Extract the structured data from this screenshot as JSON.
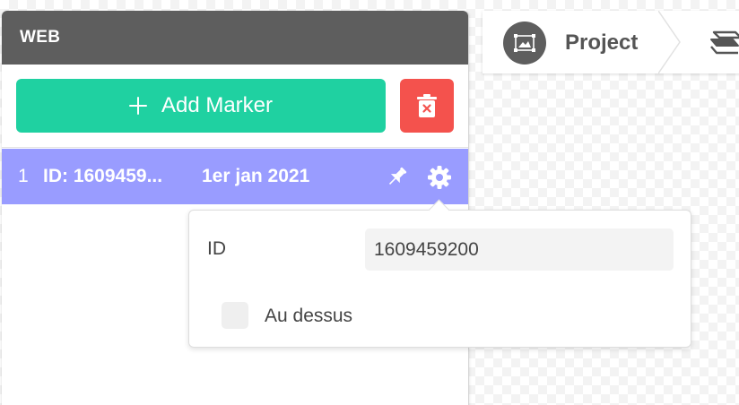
{
  "panel": {
    "title": "WEB",
    "add_marker_label": "Add Marker"
  },
  "markers": [
    {
      "index": "1",
      "id_label": "ID: 1609459...",
      "date": "1er jan 2021"
    }
  ],
  "marker_settings": {
    "id_label": "ID",
    "id_value": "1609459200",
    "on_top_label": "Au dessus",
    "on_top_checked": false
  },
  "breadcrumb": {
    "project_label": "Project"
  },
  "colors": {
    "header": "#5e5e5e",
    "add_button": "#1fd1a1",
    "delete_button": "#f4524d",
    "selected_row": "#999cff"
  },
  "icons": {
    "add": "plus-icon",
    "delete": "trash-icon",
    "pin": "pin-icon",
    "settings": "gear-icon",
    "project": "image-icon",
    "layers": "layers-icon"
  }
}
